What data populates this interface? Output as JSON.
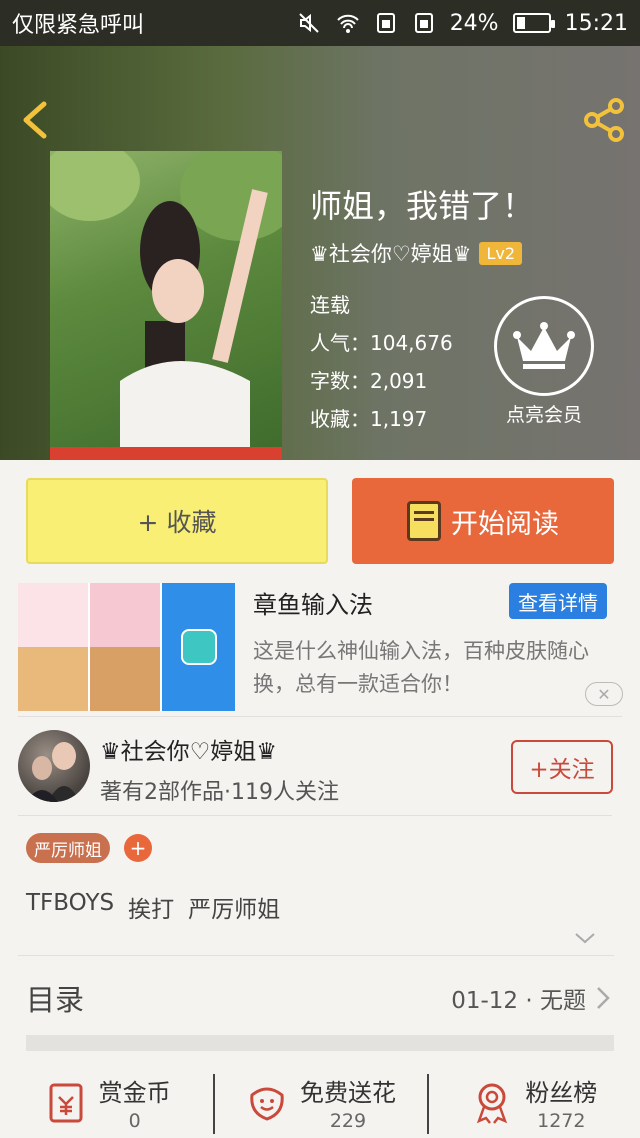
{
  "status_bar": {
    "carrier": "仅限紧急呼叫",
    "battery": "24%",
    "time": "15:21"
  },
  "book": {
    "title": "师姐，我错了！",
    "author": "♛社会你♡婷姐♛",
    "level": "Lv2",
    "status": "连载",
    "popularity": "人气：104,676",
    "words": "字数：2,091",
    "favorites": "收藏：1,197"
  },
  "vip": {
    "label": "点亮会员"
  },
  "actions": {
    "favorite_label": "+ 收藏",
    "read_label": "开始阅读"
  },
  "ad": {
    "title": "章鱼输入法",
    "button": "查看详情",
    "description": "这是什么神仙输入法，百种皮肤随心换，总有一款适合你！",
    "close": "✕"
  },
  "author_row": {
    "name": "♛社会你♡婷姐♛",
    "meta": "著有2部作品·119人关注",
    "follow": "+关注"
  },
  "tags": {
    "primary": "严厉师姐",
    "add": "+"
  },
  "keywords": [
    "TFBOYS",
    "挨打",
    "严厉师姐"
  ],
  "directory": {
    "label": "目录",
    "latest": "01-12 · 无题"
  },
  "bottom_stats": [
    {
      "label": "赏金币",
      "value": "0",
      "icon": "coin-icon"
    },
    {
      "label": "免费送花",
      "value": "229",
      "icon": "flower-icon"
    },
    {
      "label": "粉丝榜",
      "value": "1272",
      "icon": "medal-icon"
    }
  ],
  "colors": {
    "accent_orange": "#e8673b",
    "fav_yellow": "#f8ef74",
    "badge_gold": "#f0b63a",
    "follow_red": "#c94a3a",
    "ad_blue": "#2a7fe0"
  }
}
